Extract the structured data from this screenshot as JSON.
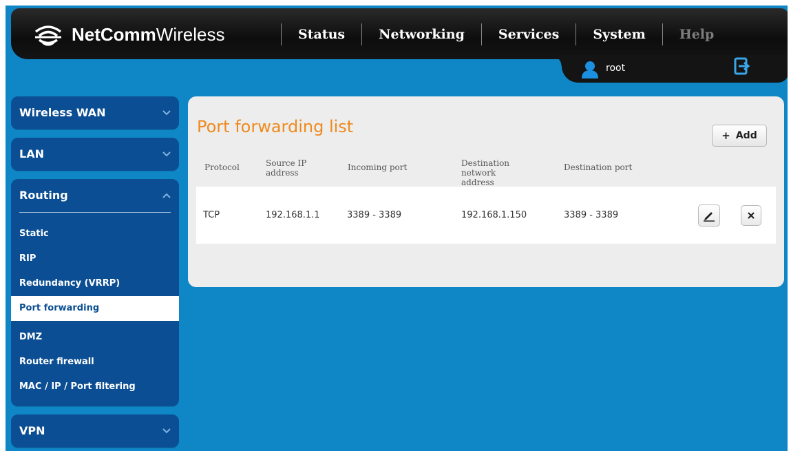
{
  "header": {
    "brand_bold": "NetComm",
    "brand_light": "Wireless",
    "nav": [
      "Status",
      "Networking",
      "Services",
      "System",
      "Help"
    ],
    "user": "root"
  },
  "sidebar": {
    "wireless_wan": "Wireless WAN",
    "lan": "LAN",
    "routing": "Routing",
    "routing_items": [
      "Static",
      "RIP",
      "Redundancy (VRRP)",
      "Port forwarding",
      "DMZ",
      "Router firewall",
      "MAC / IP / Port filtering"
    ],
    "active_item": "Port forwarding",
    "vpn": "VPN"
  },
  "main": {
    "title": "Port forwarding list",
    "add_button": "Add",
    "columns": [
      "Protocol",
      "Source IP address",
      "Incoming port",
      "Destination network address",
      "Destination port"
    ],
    "rows": [
      {
        "protocol": "TCP",
        "source_ip": "192.168.1.1",
        "incoming_port": "3389 - 3389",
        "destination_address": "192.168.1.150",
        "destination_port": "3389 - 3389"
      }
    ]
  },
  "colors": {
    "background": "#0f86c6",
    "sidebar": "#0b4e93",
    "title_accent": "#ee8a1e",
    "header": "#141414"
  },
  "icons": [
    "wifi-logo-icon",
    "user-icon",
    "logout-icon",
    "chevron-down-icon",
    "chevron-up-icon",
    "plus-icon",
    "edit-icon",
    "delete-icon"
  ]
}
